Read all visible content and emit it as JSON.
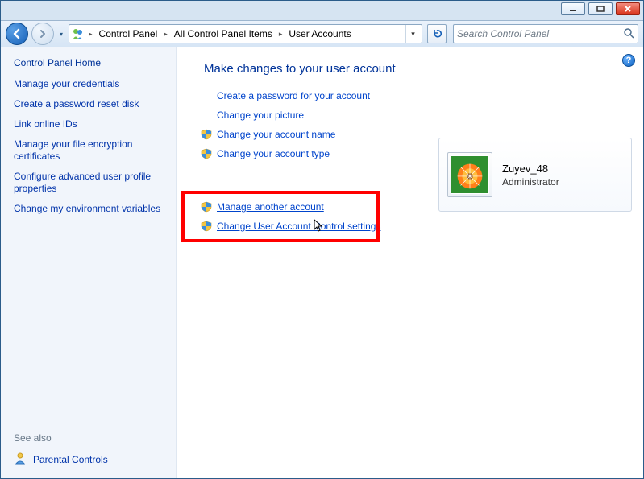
{
  "titlebar": {
    "minimize_tooltip": "Minimize",
    "maximize_tooltip": "Maximize",
    "close_tooltip": "Close"
  },
  "navbar": {
    "back_tooltip": "Back",
    "forward_tooltip": "Forward",
    "history_dropdown_tooltip": "Recent locations",
    "refresh_tooltip": "Refresh",
    "breadcrumbs": [
      {
        "label": "Control Panel"
      },
      {
        "label": "All Control Panel Items"
      },
      {
        "label": "User Accounts"
      }
    ],
    "search_placeholder": "Search Control Panel"
  },
  "sidebar": {
    "header": "Control Panel Home",
    "links": [
      "Manage your credentials",
      "Create a password reset disk",
      "Link online IDs",
      "Manage your file encryption certificates",
      "Configure advanced user profile properties",
      "Change my environment variables"
    ],
    "see_also_label": "See also",
    "parental_controls_label": "Parental Controls"
  },
  "main": {
    "heading": "Make changes to your user account",
    "actions_primary": [
      {
        "label": "Create a password for your account",
        "shield": false
      },
      {
        "label": "Change your picture",
        "shield": false
      },
      {
        "label": "Change your account name",
        "shield": true
      },
      {
        "label": "Change your account type",
        "shield": true
      }
    ],
    "actions_secondary": [
      {
        "label": "Manage another account",
        "shield": true,
        "underline": true
      },
      {
        "label": "Change User Account Control settings",
        "shield": true,
        "underline": true,
        "highlight": true
      }
    ],
    "help_tooltip": "Get help"
  },
  "card": {
    "username": "Zuyev_48",
    "role": "Administrator",
    "avatar_icon": "flower-avatar"
  },
  "colors": {
    "heading_blue": "#003399",
    "link_blue": "#0044cc",
    "sidebar_bg": "#f1f5fb",
    "highlight_red": "#ff0000"
  }
}
